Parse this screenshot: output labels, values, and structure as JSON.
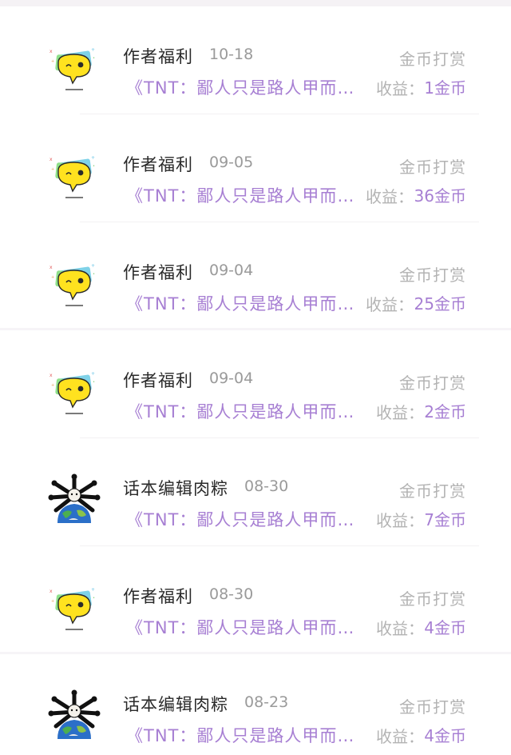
{
  "records": [
    {
      "avatar": "author-welfare-avatar",
      "name": "作者福利",
      "date": "10-18",
      "type": "金币打赏",
      "book": "《TNT：鄙人只是路人甲而已》",
      "income_label": "收益：",
      "income_value": "1金币"
    },
    {
      "avatar": "author-welfare-avatar",
      "name": "作者福利",
      "date": "09-05",
      "type": "金币打赏",
      "book": "《TNT：鄙人只是路人甲而…",
      "income_label": "收益：",
      "income_value": "36金币"
    },
    {
      "avatar": "author-welfare-avatar",
      "name": "作者福利",
      "date": "09-04",
      "type": "金币打赏",
      "book": "《TNT：鄙人只是路人甲而…",
      "income_label": "收益：",
      "income_value": "25金币"
    },
    {
      "avatar": "author-welfare-avatar",
      "name": "作者福利",
      "date": "09-04",
      "type": "金币打赏",
      "book": "《TNT：鄙人只是路人甲而已》",
      "income_label": "收益：",
      "income_value": "2金币"
    },
    {
      "avatar": "editor-avatar",
      "name": "话本编辑肉粽",
      "date": "08-30",
      "type": "金币打赏",
      "book": "《TNT：鄙人只是路人甲而已》",
      "income_label": "收益：",
      "income_value": "7金币"
    },
    {
      "avatar": "author-welfare-avatar",
      "name": "作者福利",
      "date": "08-30",
      "type": "金币打赏",
      "book": "《TNT：鄙人只是路人甲而已》",
      "income_label": "收益：",
      "income_value": "4金币"
    },
    {
      "avatar": "editor-avatar",
      "name": "话本编辑肉粽",
      "date": "08-23",
      "type": "金币打赏",
      "book": "《TNT：鄙人只是路人甲而已》",
      "income_label": "收益：",
      "income_value": "4金币"
    }
  ],
  "colors": {
    "accent": "#a77fd3",
    "muted": "#b3b3b3",
    "title": "#2a2a2a"
  }
}
